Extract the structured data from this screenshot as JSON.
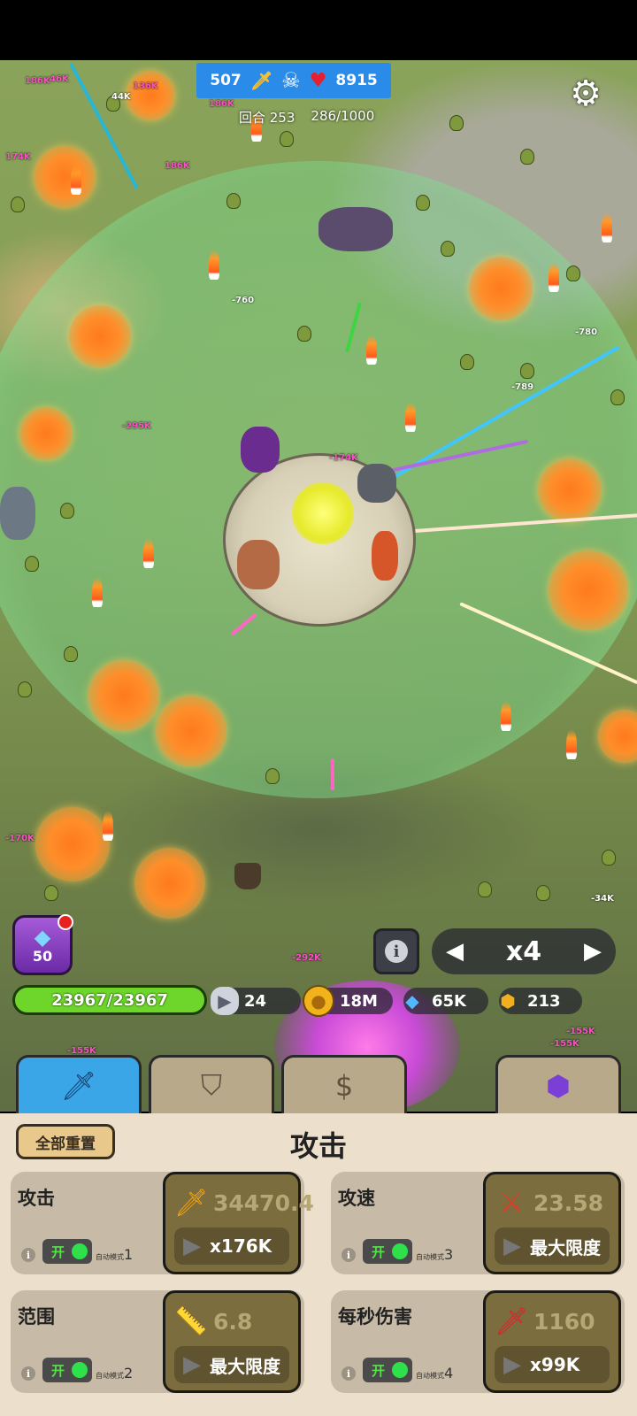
{
  "hud": {
    "kills": "507",
    "hearts": "8915",
    "round_label": "回合 253",
    "wave_progress": "286/1000"
  },
  "gem_button": {
    "count": "50",
    "has_notification": true
  },
  "speed": {
    "value": "x4"
  },
  "resources": {
    "hp": "23967/23967",
    "stones": "24",
    "coins": "18M",
    "gems": "65K",
    "tokens": "213"
  },
  "tabs": [
    {
      "id": "attack",
      "icon": "sword-icon",
      "active": true
    },
    {
      "id": "defense",
      "icon": "shield-icon",
      "active": false
    },
    {
      "id": "economy",
      "icon": "money-bag-icon",
      "active": false
    },
    {
      "id": "gems",
      "icon": "purple-gem-icon",
      "active": false
    }
  ],
  "panel": {
    "title": "攻击",
    "reset_label": "全部重置",
    "cards": [
      {
        "name": "攻击",
        "value": "34470.4",
        "cost": "x176K",
        "toggle": "开",
        "auto_label": "自动模式",
        "auto_num": "1"
      },
      {
        "name": "攻速",
        "value": "23.58",
        "cost": "最大限度",
        "toggle": "开",
        "auto_label": "自动模式",
        "auto_num": "3"
      },
      {
        "name": "范围",
        "value": "6.8",
        "cost": "最大限度",
        "toggle": "开",
        "auto_label": "自动模式",
        "auto_num": "2"
      },
      {
        "name": "每秒伤害",
        "value": "1160",
        "cost": "x99K",
        "toggle": "开",
        "auto_label": "自动模式",
        "auto_num": "4"
      }
    ]
  },
  "floating_damage": [
    "186K",
    "46K",
    "136K",
    "44K",
    "186K",
    "174K",
    "186K",
    "-760",
    "-780",
    "-789",
    "-295K",
    "-174K",
    "-170K",
    "-292K",
    "-34K",
    "-155K",
    "-155K",
    "-155K"
  ],
  "colors": {
    "tab_active": "#3aa6e8",
    "hp_bar": "#6ed62a",
    "panel_bg": "#ecdfcc"
  }
}
